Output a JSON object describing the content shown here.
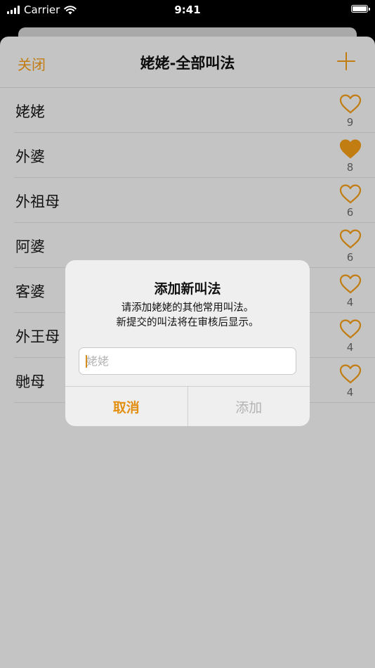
{
  "status_bar": {
    "carrier": "Carrier",
    "time": "9:41"
  },
  "nav": {
    "close_label": "关闭",
    "title": "姥姥-全部叫法",
    "add_icon": "plus-icon"
  },
  "colors": {
    "accent": "#c27d12",
    "heart_filled": "#c27d12",
    "cancel": "#e28f12",
    "disabled": "#b3b3b3"
  },
  "rows": [
    {
      "name": "姥姥",
      "count": "9",
      "liked": false
    },
    {
      "name": "外婆",
      "count": "8",
      "liked": true
    },
    {
      "name": "外祖母",
      "count": "6",
      "liked": false
    },
    {
      "name": "阿婆",
      "count": "6",
      "liked": false
    },
    {
      "name": "客婆",
      "count": "4",
      "liked": false
    },
    {
      "name": "外王母",
      "count": "4",
      "liked": false
    },
    {
      "name": "毑母",
      "count": "4",
      "liked": false
    }
  ],
  "dialog": {
    "title": "添加新叫法",
    "message_line1": "请添加姥姥的其他常用叫法。",
    "message_line2": "新提交的叫法将在审核后显示。",
    "input_placeholder": "姥姥",
    "input_value": "",
    "cancel_label": "取消",
    "add_label": "添加"
  }
}
